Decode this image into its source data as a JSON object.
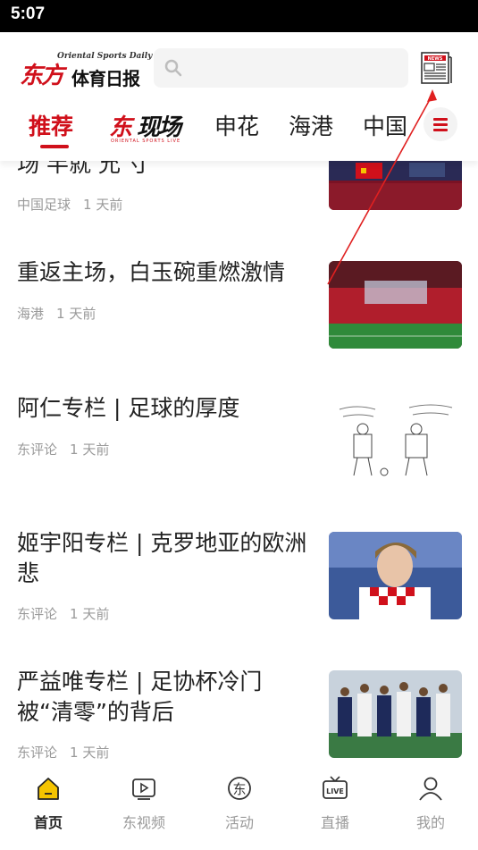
{
  "status_bar": {
    "time": "5:07"
  },
  "header": {
    "logo_cn_red": "东方",
    "logo_cn_black": "体育日报",
    "logo_en": "Oriental Sports Daily",
    "search_placeholder": "",
    "news_icon_label": "NEWS"
  },
  "tabs": [
    {
      "label": "推荐",
      "active": true
    },
    {
      "label": "东现场",
      "logo": true,
      "logo_red": "东",
      "logo_black": "现场",
      "sub": "ORIENTAL SPORTS LIVE"
    },
    {
      "label": "申花"
    },
    {
      "label": "海港"
    },
    {
      "label": "中国"
    }
  ],
  "feed": [
    {
      "title": "场  半就  允  寸",
      "category": "中国足球",
      "time": "1 天前"
    },
    {
      "title": "重返主场，白玉碗重燃激情",
      "category": "海港",
      "time": "1 天前"
    },
    {
      "title": "阿仁专栏 | 足球的厚度",
      "category": "东评论",
      "time": "1 天前"
    },
    {
      "title": "姬宇阳专栏 | 克罗地亚的欧洲悲",
      "category": "东评论",
      "time": "1 天前"
    },
    {
      "title": "严益唯专栏 | 足协杯冷门被“清零”的背后",
      "category": "东评论",
      "time": "1 天前"
    }
  ],
  "bottom_nav": [
    {
      "label": "首页",
      "icon": "home-icon",
      "active": true
    },
    {
      "label": "东视频",
      "icon": "video-icon"
    },
    {
      "label": "活动",
      "icon": "activity-icon"
    },
    {
      "label": "直播",
      "icon": "live-icon"
    },
    {
      "label": "我的",
      "icon": "profile-icon"
    }
  ],
  "colors": {
    "accent": "#d0101b",
    "active_nav": "#f5c400",
    "muted": "#9a9a9a"
  }
}
